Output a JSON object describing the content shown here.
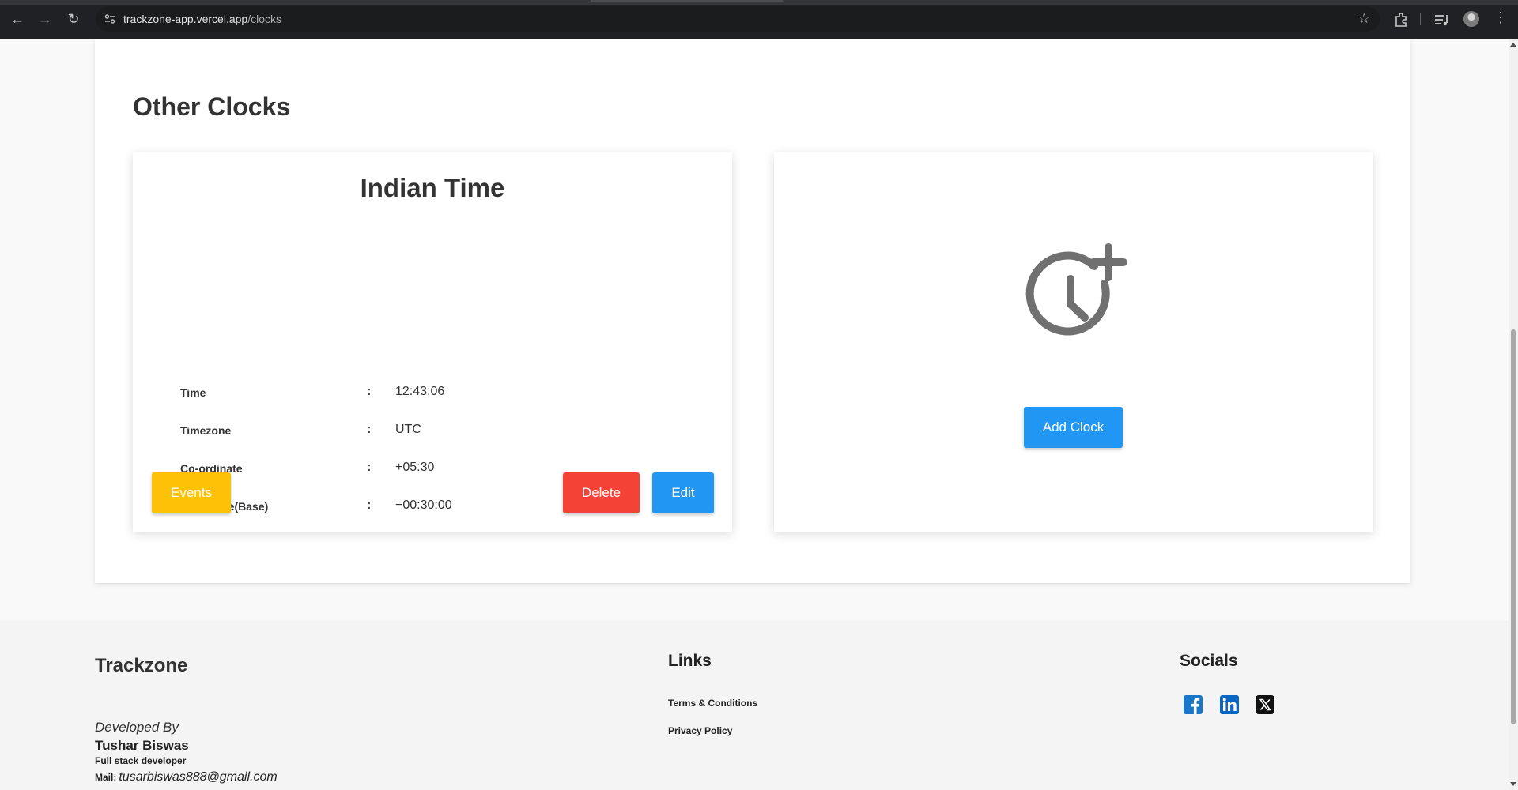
{
  "browser": {
    "url_host": "trackzone-app.vercel.app",
    "url_path": "/clocks"
  },
  "page": {
    "section_title": "Other Clocks"
  },
  "clock_card": {
    "title": "Indian Time",
    "rows": [
      {
        "label": "Time",
        "value": "12:43:06"
      },
      {
        "label": "Timezone",
        "value": "UTC"
      },
      {
        "label": "Co-ordinate",
        "value": "+05:30"
      },
      {
        "label": "Difference(Base)",
        "value": "−00:30:00"
      }
    ],
    "separator": ":",
    "buttons": {
      "events": "Events",
      "delete": "Delete",
      "edit": "Edit"
    },
    "colors": {
      "events": "#ffc107",
      "delete": "#f44336",
      "edit": "#2196f3"
    }
  },
  "add_card": {
    "icon": "clock-plus-icon",
    "button": "Add Clock"
  },
  "footer": {
    "brand": "Trackzone",
    "developed_by": "Developed By",
    "developer_name": "Tushar Biswas",
    "developer_role": "Full stack developer",
    "mail_label": "Mail:",
    "mail": "tusarbiswas888@gmail.com",
    "links_title": "Links",
    "links": [
      "Terms & Conditions",
      "Privacy Policy"
    ],
    "socials_title": "Socials",
    "socials": [
      "facebook-icon",
      "linkedin-icon",
      "x-icon"
    ]
  }
}
